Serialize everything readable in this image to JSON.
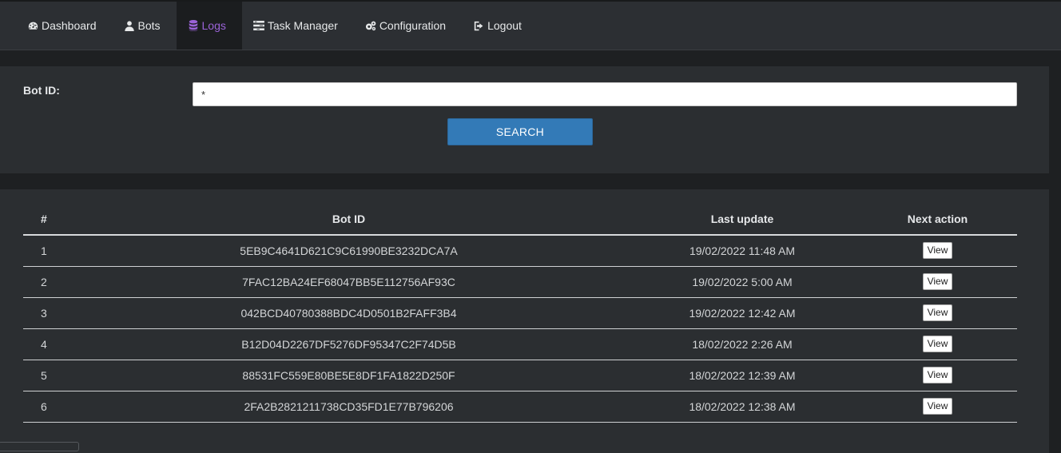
{
  "nav": {
    "items": [
      {
        "label": "Dashboard",
        "icon": "dashboard-icon",
        "active": false
      },
      {
        "label": "Bots",
        "icon": "user-icon",
        "active": false
      },
      {
        "label": "Logs",
        "icon": "database-icon",
        "active": true
      },
      {
        "label": "Task Manager",
        "icon": "tasks-icon",
        "active": false
      },
      {
        "label": "Configuration",
        "icon": "gears-icon",
        "active": false
      },
      {
        "label": "Logout",
        "icon": "sign-out-icon",
        "active": false
      }
    ],
    "active_color": "#9b63d8"
  },
  "search": {
    "label": "Bot ID:",
    "value": "*",
    "button_label": "SEARCH",
    "button_color": "#337ab7"
  },
  "table": {
    "headers": [
      "#",
      "Bot ID",
      "Last update",
      "Next action"
    ],
    "rows": [
      {
        "num": "1",
        "bot_id": "5EB9C4641D621C9C61990BE3232DCA7A",
        "last_update": "19/02/2022 11:48 AM",
        "action": "View"
      },
      {
        "num": "2",
        "bot_id": "7FAC12BA24EF68047BB5E112756AF93C",
        "last_update": "19/02/2022 5:00 AM",
        "action": "View"
      },
      {
        "num": "3",
        "bot_id": "042BCD40780388BDC4D0501B2FAFF3B4",
        "last_update": "19/02/2022 12:42 AM",
        "action": "View"
      },
      {
        "num": "4",
        "bot_id": "B12D04D2267DF5276DF95347C2F74D5B",
        "last_update": "18/02/2022 2:26 AM",
        "action": "View"
      },
      {
        "num": "5",
        "bot_id": "88531FC559E80BE5E8DF1FA1822D250F",
        "last_update": "18/02/2022 12:39 AM",
        "action": "View"
      },
      {
        "num": "6",
        "bot_id": "2FA2B2821211738CD35FD1E77B796206",
        "last_update": "18/02/2022 12:38 AM",
        "action": "View"
      }
    ]
  }
}
